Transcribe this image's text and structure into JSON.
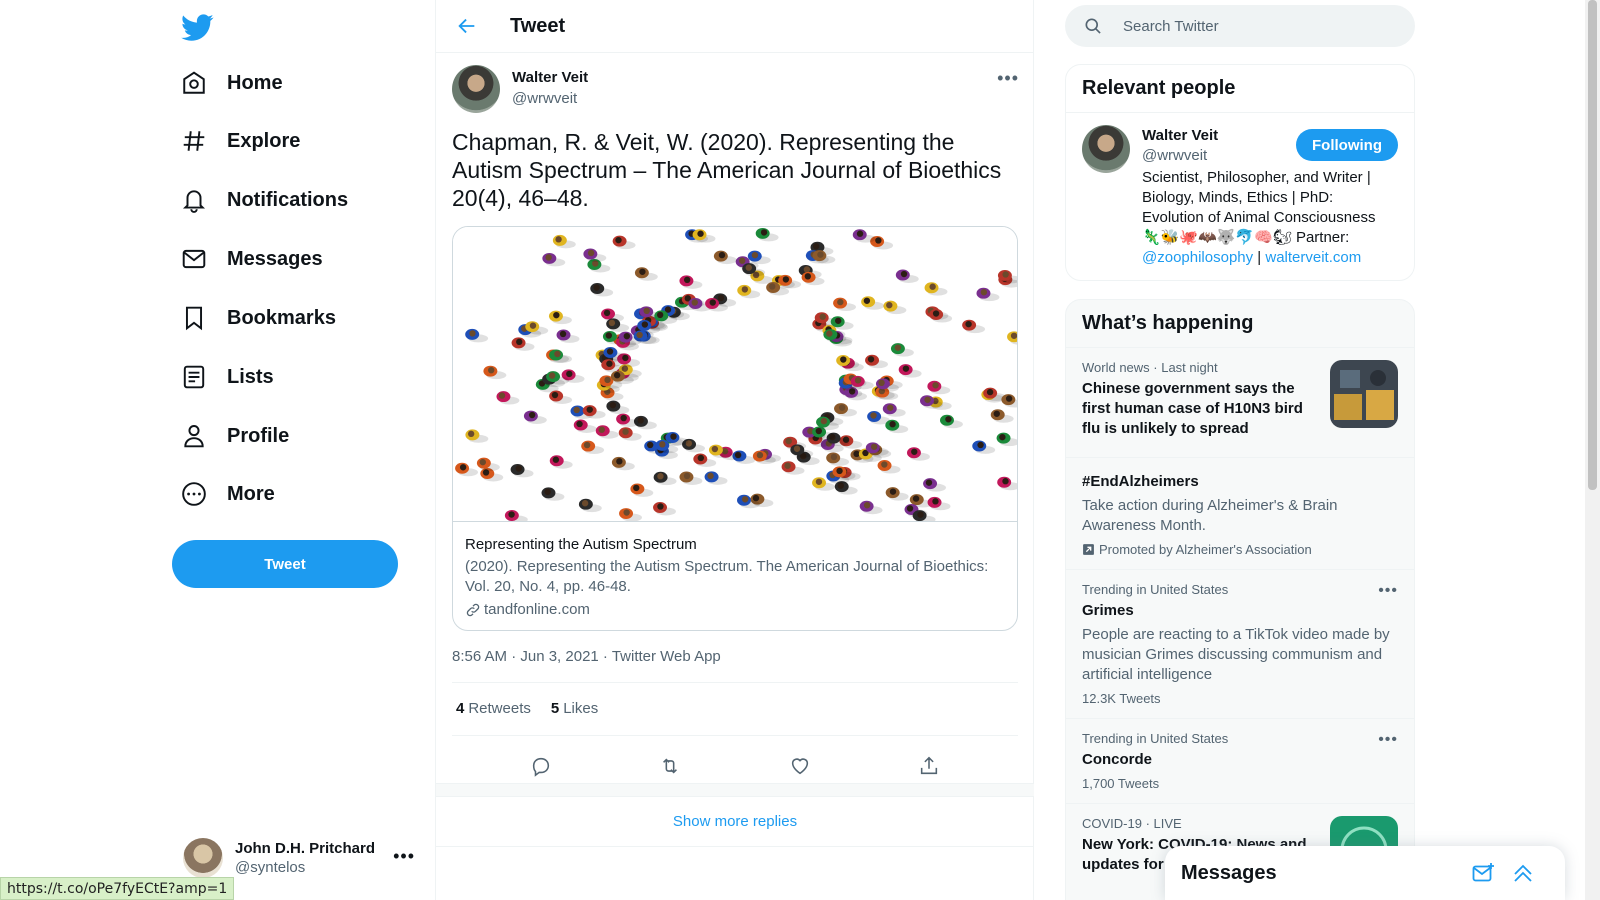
{
  "nav": {
    "items": [
      {
        "label": "Home",
        "icon": "home-icon"
      },
      {
        "label": "Explore",
        "icon": "hashtag-icon"
      },
      {
        "label": "Notifications",
        "icon": "bell-icon"
      },
      {
        "label": "Messages",
        "icon": "envelope-icon"
      },
      {
        "label": "Bookmarks",
        "icon": "bookmark-icon"
      },
      {
        "label": "Lists",
        "icon": "list-icon"
      },
      {
        "label": "Profile",
        "icon": "person-icon"
      },
      {
        "label": "More",
        "icon": "more-circle-icon"
      }
    ],
    "tweet_button": "Tweet"
  },
  "account": {
    "name": "John D.H. Pritchard",
    "handle": "@syntelos"
  },
  "status_url": "https://t.co/oPe7fyECtE?amp=1",
  "header": {
    "title": "Tweet"
  },
  "tweet": {
    "author_name": "Walter Veit",
    "author_handle": "@wrwveit",
    "text": "Chapman, R. & Veit, W. (2020). Representing the Autism Spectrum – The American Journal of Bioethics 20(4), 46–48.",
    "card": {
      "title": "Representing the Autism Spectrum",
      "description": "(2020). Representing the Autism Spectrum. The American Journal of Bioethics: Vol. 20, No. 4, pp. 46-48.",
      "domain": "tandfonline.com"
    },
    "time": "8:56 AM · Jun 3, 2021 · ",
    "source": "Twitter Web App",
    "retweets_count": "4",
    "retweets_label": "Retweets",
    "likes_count": "5",
    "likes_label": "Likes"
  },
  "show_more_replies": "Show more replies",
  "search": {
    "placeholder": "Search Twitter"
  },
  "relevant": {
    "title": "Relevant people",
    "name": "Walter Veit",
    "handle": "@wrwveit",
    "follow_label": "Following",
    "bio_text": "Scientist, Philosopher, and Writer | Biology, Minds, Ethics | PhD: Evolution of Animal Consciousness",
    "bio_emoji": "🦎🐝🐙🦇🐺🐬🧠🐿",
    "bio_partner": " Partner:",
    "bio_mention": "@zoophilosophy",
    "bio_sep": " | ",
    "bio_site": "walterveit.com"
  },
  "happening": {
    "title": "What’s happening",
    "trends": [
      {
        "context": "World news · Last night",
        "title": "Chinese government says the first human case of H10N3 bird flu is unlikely to spread"
      },
      {
        "title": "#EndAlzheimers",
        "desc": "Take action during Alzheimer's & Brain Awareness Month.",
        "promoted": "Promoted by Alzheimer's Association"
      },
      {
        "context": "Trending in United States",
        "title": "Grimes",
        "desc": "People are reacting to a TikTok video made by musician Grimes discussing communism and artificial intelligence",
        "count": "12.3K Tweets"
      },
      {
        "context": "Trending in United States",
        "title": "Concorde",
        "count": "1,700 Tweets"
      },
      {
        "context": "COVID-19 · LIVE",
        "title": "New York: COVID-19: News and updates for"
      }
    ]
  },
  "dock": {
    "title": "Messages"
  },
  "colors": {
    "accent": "#1d9bf0",
    "text": "#0f1419",
    "muted": "#536471"
  }
}
